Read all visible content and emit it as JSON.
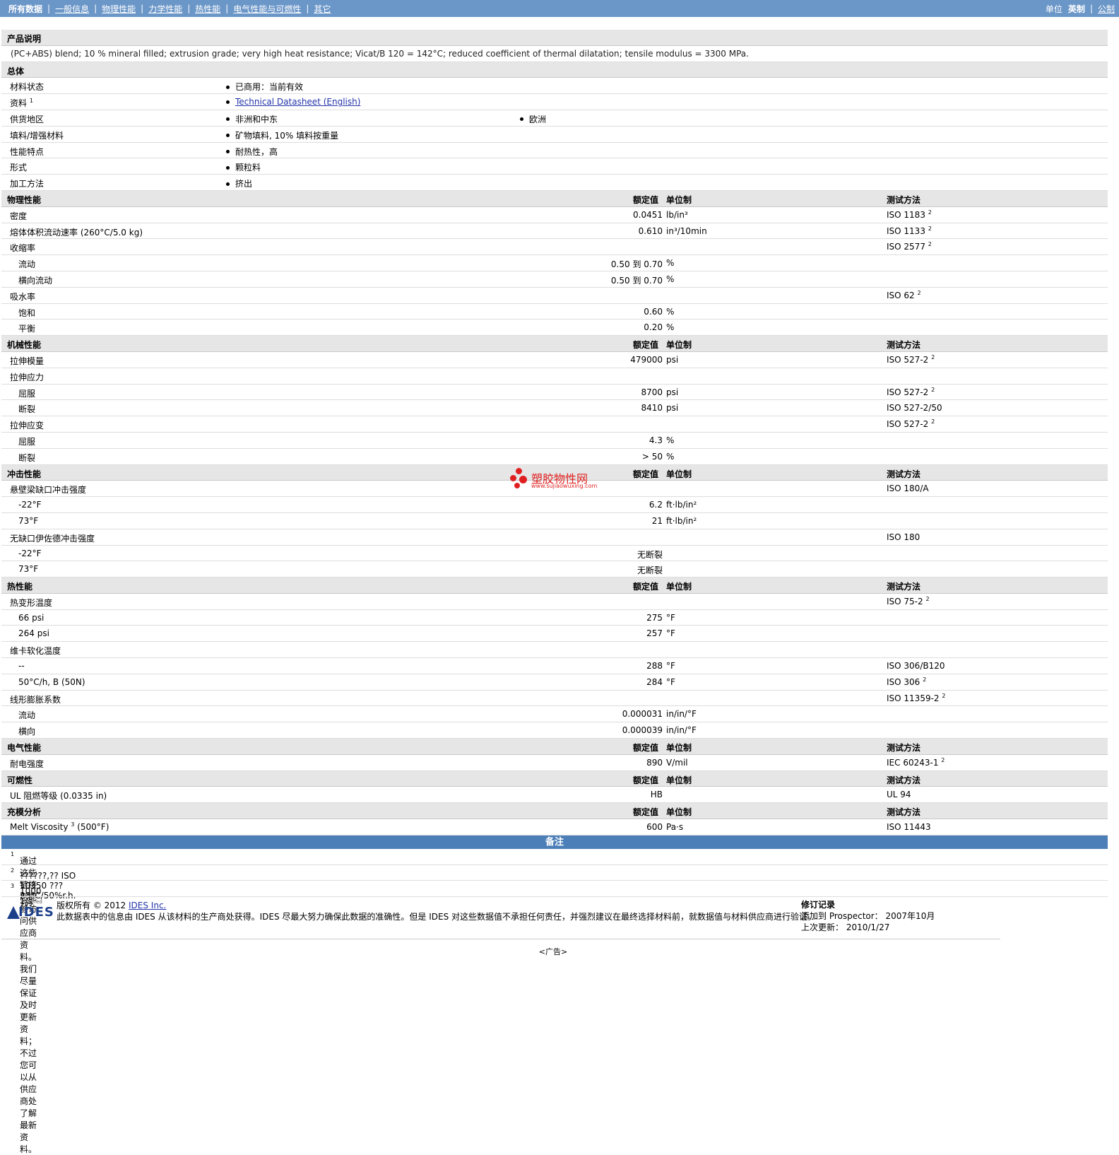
{
  "nav": {
    "tabs": [
      "所有数据",
      "一般信息",
      "物理性能",
      "力学性能",
      "热性能",
      "电气性能与可燃性",
      "其它"
    ],
    "units_label": "单位",
    "unit_english": "英制",
    "unit_metric": "公制"
  },
  "colors": {
    "nav_bg": "#6b96c8",
    "section_bg": "#e6e6e6",
    "notes_bg": "#4c7fb8"
  },
  "product": {
    "heading": "产品说明",
    "text": "(PC+ABS) blend; 10 % mineral filled; extrusion grade; very high heat resistance; Vicat/B 120 = 142°C; reduced coefficient of thermal dilatation; tensile modulus = 3300 MPa."
  },
  "general": {
    "heading": "总体",
    "rows": [
      {
        "label": "材料状态",
        "sup": "",
        "items": [
          "已商用：当前有效"
        ]
      },
      {
        "label": "资料",
        "sup": "1",
        "items": [
          "Technical Datasheet (English)"
        ],
        "link": true
      },
      {
        "label": "供货地区",
        "sup": "",
        "items": [
          "非洲和中东",
          "欧洲"
        ]
      },
      {
        "label": "填料/增强材料",
        "sup": "",
        "items": [
          "矿物填料, 10% 填料按重量"
        ]
      },
      {
        "label": "性能特点",
        "sup": "",
        "items": [
          "耐热性，高"
        ]
      },
      {
        "label": "形式",
        "sup": "",
        "items": [
          "颗粒料"
        ]
      },
      {
        "label": "加工方法",
        "sup": "",
        "items": [
          "挤出"
        ]
      }
    ]
  },
  "col_headers": {
    "value": "额定值",
    "unit": "单位制",
    "test": "测试方法"
  },
  "sections": [
    {
      "heading": "物理性能",
      "rows": [
        {
          "label": "密度",
          "sub": false,
          "value": "0.0451",
          "unit": "lb/in³",
          "test": "ISO 1183",
          "sup": "2"
        },
        {
          "label": "熔体体积流动速率",
          "cond": "(260°C/5.0 kg)",
          "sub": false,
          "value": "0.610",
          "unit": "in³/10min",
          "test": "ISO 1133",
          "sup": "2"
        },
        {
          "label": "收缩率",
          "sub": false,
          "value": "",
          "unit": "",
          "test": "ISO 2577",
          "sup": "2"
        },
        {
          "label": "流动",
          "sub": true,
          "value": "0.50 到  0.70",
          "unit": "%",
          "test": "",
          "sup": ""
        },
        {
          "label": "横向流动",
          "sub": true,
          "value": "0.50 到  0.70",
          "unit": "%",
          "test": "",
          "sup": ""
        },
        {
          "label": "吸水率",
          "sub": false,
          "value": "",
          "unit": "",
          "test": "ISO 62",
          "sup": "2"
        },
        {
          "label": "饱和",
          "sub": true,
          "value": "0.60",
          "unit": "%",
          "test": "",
          "sup": ""
        },
        {
          "label": "平衡",
          "sub": true,
          "value": "0.20",
          "unit": "%",
          "test": "",
          "sup": ""
        }
      ]
    },
    {
      "heading": "机械性能",
      "rows": [
        {
          "label": "拉伸模量",
          "sub": false,
          "value": "479000",
          "unit": "psi",
          "test": "ISO 527-2",
          "sup": "2"
        },
        {
          "label": "拉伸应力",
          "sub": false,
          "value": "",
          "unit": "",
          "test": "",
          "sup": ""
        },
        {
          "label": "屈服",
          "sub": true,
          "value": "8700",
          "unit": "psi",
          "test": "ISO 527-2",
          "sup": "2"
        },
        {
          "label": "断裂",
          "sub": true,
          "value": "8410",
          "unit": "psi",
          "test": "ISO 527-2/50",
          "sup": ""
        },
        {
          "label": "拉伸应变",
          "sub": false,
          "value": "",
          "unit": "",
          "test": "ISO 527-2",
          "sup": "2"
        },
        {
          "label": "屈服",
          "sub": true,
          "value": "4.3",
          "unit": "%",
          "test": "",
          "sup": ""
        },
        {
          "label": "断裂",
          "sub": true,
          "value": "> 50",
          "unit": "%",
          "test": "",
          "sup": ""
        }
      ]
    },
    {
      "heading": "冲击性能",
      "rows": [
        {
          "label": "悬壁梁缺口冲击强度",
          "sub": false,
          "value": "",
          "unit": "",
          "test": "ISO 180/A",
          "sup": ""
        },
        {
          "label": "-22°F",
          "sub": true,
          "value": "6.2",
          "unit": "ft·lb/in²",
          "test": "",
          "sup": ""
        },
        {
          "label": "73°F",
          "sub": true,
          "value": "21",
          "unit": "ft·lb/in²",
          "test": "",
          "sup": ""
        },
        {
          "label": "无缺口伊佐德冲击强度",
          "sub": false,
          "value": "",
          "unit": "",
          "test": "ISO 180",
          "sup": ""
        },
        {
          "label": "-22°F",
          "sub": true,
          "value": "无断裂",
          "unit": "",
          "test": "",
          "sup": ""
        },
        {
          "label": "73°F",
          "sub": true,
          "value": "无断裂",
          "unit": "",
          "test": "",
          "sup": ""
        }
      ]
    },
    {
      "heading": "热性能",
      "rows": [
        {
          "label": "热变形温度",
          "sub": false,
          "value": "",
          "unit": "",
          "test": "ISO 75-2",
          "sup": "2"
        },
        {
          "label": "66 psi",
          "sub": true,
          "value": "275",
          "unit": "°F",
          "test": "",
          "sup": ""
        },
        {
          "label": "264 psi",
          "sub": true,
          "value": "257",
          "unit": "°F",
          "test": "",
          "sup": ""
        },
        {
          "label": "维卡软化温度",
          "sub": false,
          "value": "",
          "unit": "",
          "test": "",
          "sup": ""
        },
        {
          "label": "--",
          "sub": true,
          "value": "288",
          "unit": "°F",
          "test": "ISO 306/B120",
          "sup": ""
        },
        {
          "label": "50°C/h, B (50N)",
          "sub": true,
          "value": "284",
          "unit": "°F",
          "test": "ISO 306",
          "sup": "2"
        },
        {
          "label": "线形膨胀系数",
          "sub": false,
          "value": "",
          "unit": "",
          "test": "ISO 11359-2",
          "sup": "2"
        },
        {
          "label": "流动",
          "sub": true,
          "value": "0.000031",
          "unit": "in/in/°F",
          "test": "",
          "sup": ""
        },
        {
          "label": "横向",
          "sub": true,
          "value": "0.000039",
          "unit": "in/in/°F",
          "test": "",
          "sup": ""
        }
      ]
    },
    {
      "heading": "电气性能",
      "rows": [
        {
          "label": "耐电强度",
          "sub": false,
          "value": "890",
          "unit": "V/mil",
          "test": "IEC 60243-1",
          "sup": "2"
        }
      ]
    },
    {
      "heading": "可燃性",
      "rows": [
        {
          "label": "UL 阻燃等级",
          "cond": "(0.0335 in)",
          "sub": false,
          "value": "HB",
          "unit": "",
          "test": "UL 94",
          "sup": ""
        }
      ]
    },
    {
      "heading": "充模分析",
      "rows": [
        {
          "label": "Melt Viscosity",
          "labelsup": "3",
          "cond": "(500°F)",
          "sub": false,
          "value": "600",
          "unit": "Pa·s",
          "test": "ISO 11443",
          "sup": ""
        }
      ]
    }
  ],
  "notes": {
    "heading": "备注",
    "items": [
      {
        "n": "1",
        "text": "通过这些链接您能够访问供应商资料。我们尽量保证及时更新资料；不过您可以从供应商处了解最新资料。"
      },
      {
        "n": "2",
        "text": "??????,?? ISO 10350 ??? 23°C/50%r.h. ???"
      },
      {
        "n": "3",
        "text": "1000 1/s"
      }
    ]
  },
  "footer": {
    "powered_by": "Powered by",
    "logo": "IDES",
    "copyright": "版权所有 © 2012",
    "company": "IDES Inc.",
    "disclaimer": "此数据表中的信息由 IDES 从该材料的生产商处获得。IDES 尽最大努力确保此数据的准确性。但是 IDES 对这些数据值不承担任何责任，并强烈建议在最终选择材料前，就数据值与材料供应商进行验证。",
    "rev_heading": "修订记录",
    "added_label": "添加到 Prospector：",
    "added_value": "2007年10月",
    "updated_label": "上次更新：",
    "updated_value": "2010/1/27",
    "ad": "<广告>"
  },
  "watermark": {
    "text": "塑胶物性网",
    "url": "www.sujiaowuxing.com"
  }
}
